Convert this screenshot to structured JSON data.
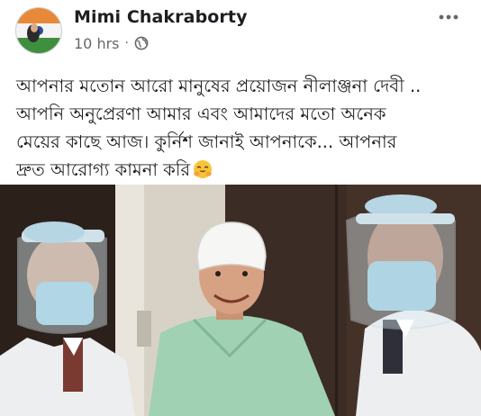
{
  "post": {
    "author": "Mimi Chakraborty",
    "time": "10 hrs",
    "separator": "·",
    "privacy_icon": "globe-icon",
    "more_icon": "more-options-icon",
    "text_lines": [
      "আপনার মতোন আরো মানুষের প্রয়োজন নীলাঞ্জনা দেবী ..",
      "আপনি অনুপ্রেরণা আমার এবং আমাদের মতো অনেক",
      "মেয়ের কাছে আজ। কুর্নিশ জানাই আপনাকে... আপনার",
      "দ্রুত আরোগ্য কামনা করি"
    ],
    "emoji": "hugging-face-emoji"
  },
  "colors": {
    "author": "#1c1e21",
    "meta": "#65676b",
    "text": "#1c1e21"
  }
}
